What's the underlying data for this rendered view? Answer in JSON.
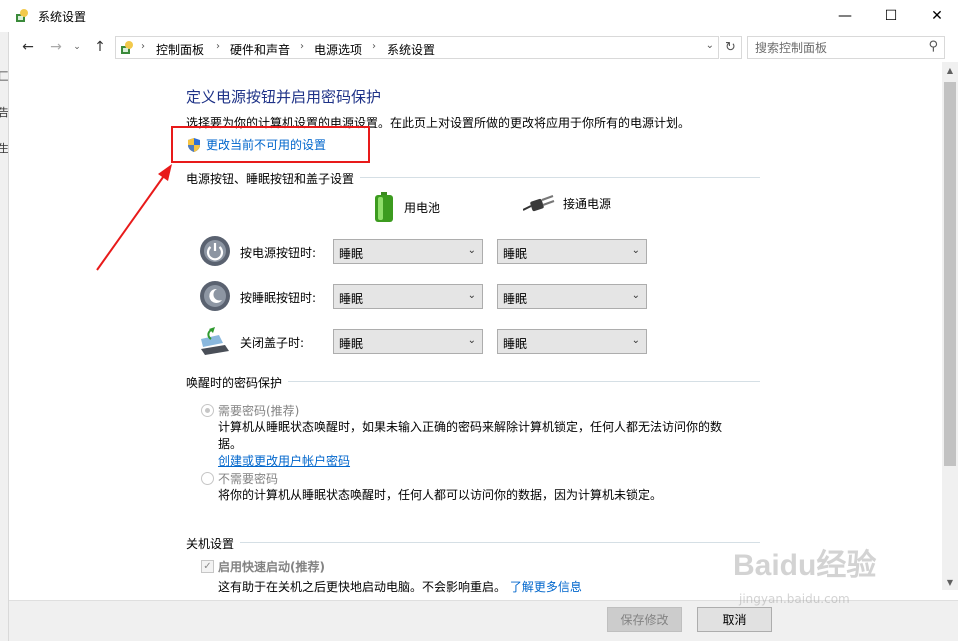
{
  "window": {
    "title": "系统设置",
    "minimize_glyph": "—",
    "maximize_glyph": "☐",
    "close_glyph": "✕"
  },
  "left_strip": {
    "fragments": [
      "匚",
      "告",
      "生"
    ]
  },
  "navigation": {
    "back_glyph": "←",
    "forward_glyph": "→",
    "recent_glyph": "⌄",
    "up_glyph": "↑",
    "breadcrumbs": [
      "控制面板",
      "硬件和声音",
      "电源选项",
      "系统设置"
    ],
    "separator": "›",
    "dropdown_glyph": "⌄",
    "refresh_glyph": "↻"
  },
  "search": {
    "placeholder": "搜索控制面板",
    "icon": "search-icon"
  },
  "page": {
    "heading": "定义电源按钮并启用密码保护",
    "description": "选择要为你的计算机设置的电源设置。在此页上对设置所做的更改将应用于你所有的电源计划。",
    "change_link": "更改当前不可用的设置"
  },
  "power_section": {
    "title": "电源按钮、睡眠按钮和盖子设置",
    "col_battery": "用电池",
    "col_plugged": "接通电源",
    "rows": [
      {
        "label": "按电源按钮时:",
        "battery": "睡眠",
        "plugged": "睡眠",
        "icon": "power-button-icon"
      },
      {
        "label": "按睡眠按钮时:",
        "battery": "睡眠",
        "plugged": "睡眠",
        "icon": "sleep-button-icon"
      },
      {
        "label": "关闭盖子时:",
        "battery": "睡眠",
        "plugged": "睡眠",
        "icon": "laptop-lid-icon"
      }
    ]
  },
  "wake_section": {
    "title": "唤醒时的密码保护",
    "require_label": "需要密码(推荐)",
    "require_desc": "计算机从睡眠状态唤醒时，如果未输入正确的密码来解除计算机锁定，任何人都无法访问你的数据。",
    "require_link": "创建或更改用户帐户密码",
    "no_require_label": "不需要密码",
    "no_require_desc": "将你的计算机从睡眠状态唤醒时，任何人都可以访问你的数据，因为计算机未锁定。"
  },
  "shutdown_section": {
    "title": "关机设置",
    "fast_startup_label": "启用快速启动(推荐)",
    "fast_startup_desc": "这有助于在关机之后更快地启动电脑。不会影响重启。",
    "learn_more": "了解更多信息"
  },
  "footer": {
    "save_label": "保存修改",
    "cancel_label": "取消"
  },
  "watermark": {
    "main": "Baidu经验",
    "sub": "jingyan.baidu.com"
  },
  "colors": {
    "heading": "#1e3287",
    "link": "#0066cc",
    "highlight": "#e81a1a"
  }
}
